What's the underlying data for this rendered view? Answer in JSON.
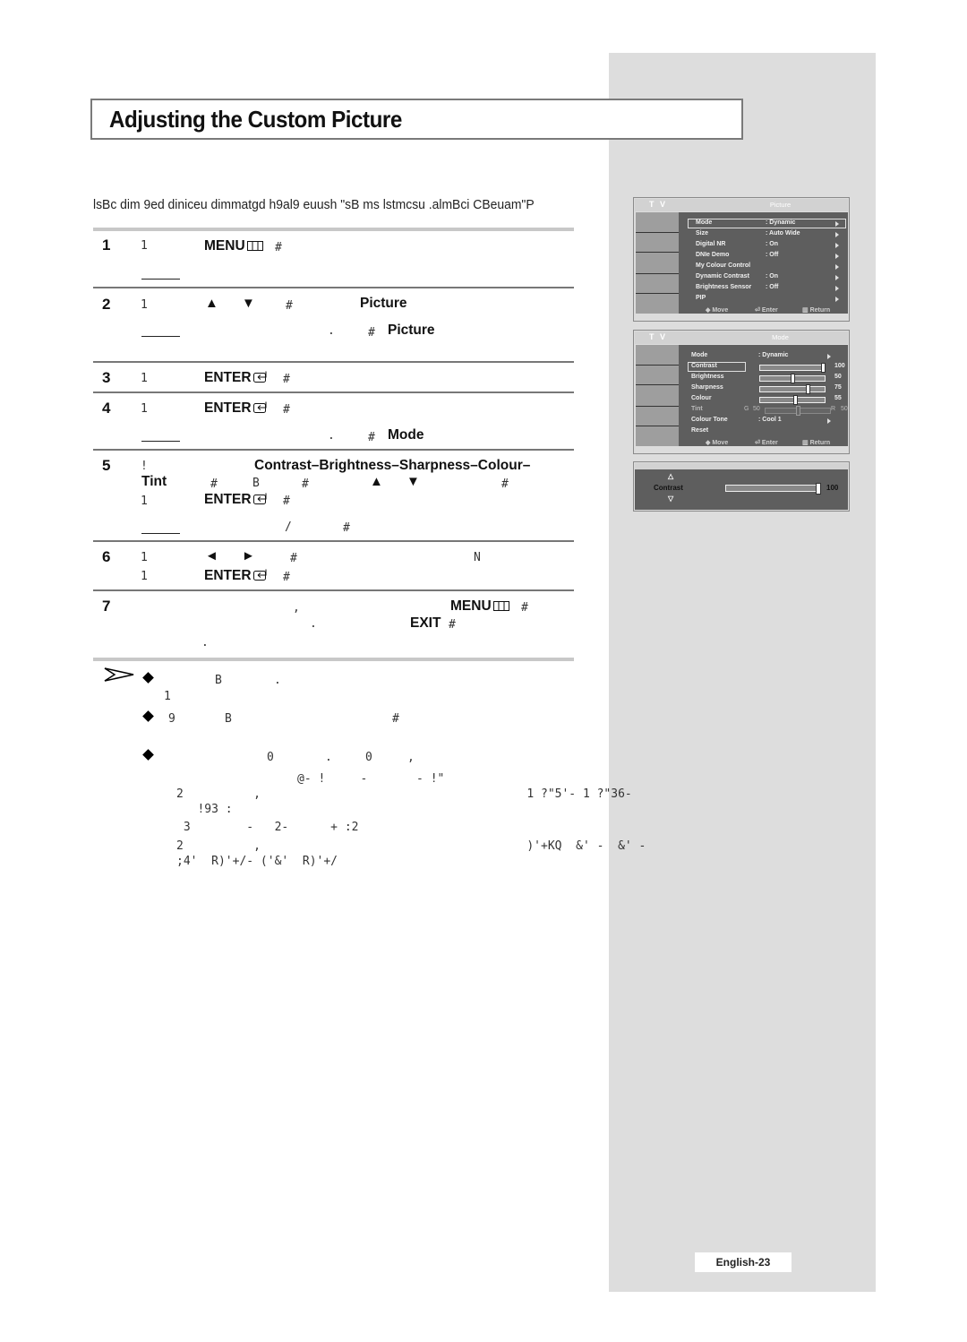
{
  "page": {
    "title": "Adjusting the Custom Picture",
    "intro": "lsBc dim 9ed diniceu dimmatgd h9al9 euush \"sB ms lstmcsu .almBci CBeuam\"P",
    "page_number": "English-23"
  },
  "steps": [
    {
      "num": "1",
      "glyph": "1",
      "key": "MENU",
      "key_icon": "menu-icon",
      "mark": "#"
    },
    {
      "num": "2",
      "glyph": "1",
      "arrows": [
        "▲",
        "▼"
      ],
      "mark": "#",
      "bold": "Picture",
      "line2_dot": ".",
      "line2_mark": "#",
      "line2_bold": "Picture"
    },
    {
      "num": "3",
      "glyph": "1",
      "key": "ENTER",
      "key_icon": "enter-icon",
      "mark": "#"
    },
    {
      "num": "4",
      "glyph": "1",
      "key": "ENTER",
      "key_icon": "enter-icon",
      "mark": "#",
      "line2_dot": ".",
      "line2_mark": "#",
      "line2_bold": "Mode"
    },
    {
      "num": "5",
      "glyph": "!",
      "bold": "Contrast–Brightness–Sharpness–Colour–",
      "bold2": "Tint",
      "mark": "#",
      "glyphB": "B",
      "mark2": "#",
      "arrows": [
        "▲",
        "▼"
      ],
      "mark3": "#",
      "line3_glyph": "1",
      "key": "ENTER",
      "key_icon": "enter-icon",
      "line3_mark": "#",
      "line4_slash": "/",
      "line4_mark": "#"
    },
    {
      "num": "6",
      "glyph": "1",
      "arrows": [
        "◄",
        "►"
      ],
      "mark": "#",
      "glyphN": "N",
      "line2_glyph": "1",
      "key": "ENTER",
      "key_icon": "enter-icon",
      "line2_mark": "#"
    },
    {
      "num": "7",
      "comma": ",",
      "key": "MENU",
      "key_icon": "menu-icon",
      "mark": "#",
      "dot": ".",
      "key2": "EXIT",
      "mark2": "#",
      "dot2": "."
    }
  ],
  "notes": {
    "n1": {
      "b": "B",
      "dot": ".",
      "l2": "1"
    },
    "n2": {
      "nine": "9",
      "b": "B",
      "mark": "#"
    },
    "n3": {
      "z1": "0",
      "dot": ".",
      "z2": "0",
      "comma": ","
    },
    "garbled": [
      "@- !     -       - !\"",
      "2          ,                                      1 ?\"5'- 1 ?\"36-",
      "   !93 :",
      " 3        -   2-      + :2",
      "2          ,                                      )'+KQ  &' -  &' -",
      ";4'  R)'+/- ('&'  R)'+/"
    ]
  },
  "osd_picture": {
    "brand": "T V",
    "title": "Picture",
    "items": [
      {
        "label": "Mode",
        "value": ": Dynamic"
      },
      {
        "label": "Size",
        "value": ": Auto Wide"
      },
      {
        "label": "Digital NR",
        "value": ": On"
      },
      {
        "label": "DNIe Demo",
        "value": ": Off"
      },
      {
        "label": "My Colour Control",
        "value": ""
      },
      {
        "label": "Dynamic Contrast",
        "value": ": On"
      },
      {
        "label": "Brightness Sensor",
        "value": ": Off"
      },
      {
        "label": "PIP",
        "value": ""
      }
    ],
    "footer": {
      "move": "Move",
      "enter": "Enter",
      "return": "Return"
    }
  },
  "osd_mode": {
    "brand": "T V",
    "title": "Mode",
    "mode": {
      "label": "Mode",
      "value": ": Dynamic"
    },
    "sliders": [
      {
        "label": "Contrast",
        "value": 100,
        "display": "100"
      },
      {
        "label": "Brightness",
        "value": 50,
        "display": "50"
      },
      {
        "label": "Sharpness",
        "value": 75,
        "display": "75"
      },
      {
        "label": "Colour",
        "value": 55,
        "display": "55"
      }
    ],
    "tint": {
      "label": "Tint",
      "g_label": "G",
      "g_value": "50",
      "r_label": "R",
      "r_value": "50",
      "balance": 50
    },
    "colour_tone": {
      "label": "Colour Tone",
      "value": ": Cool 1"
    },
    "reset": "Reset",
    "footer": {
      "move": "Move",
      "enter": "Enter",
      "return": "Return"
    }
  },
  "osd_contrast": {
    "label": "Contrast",
    "value": 100,
    "display": "100"
  }
}
